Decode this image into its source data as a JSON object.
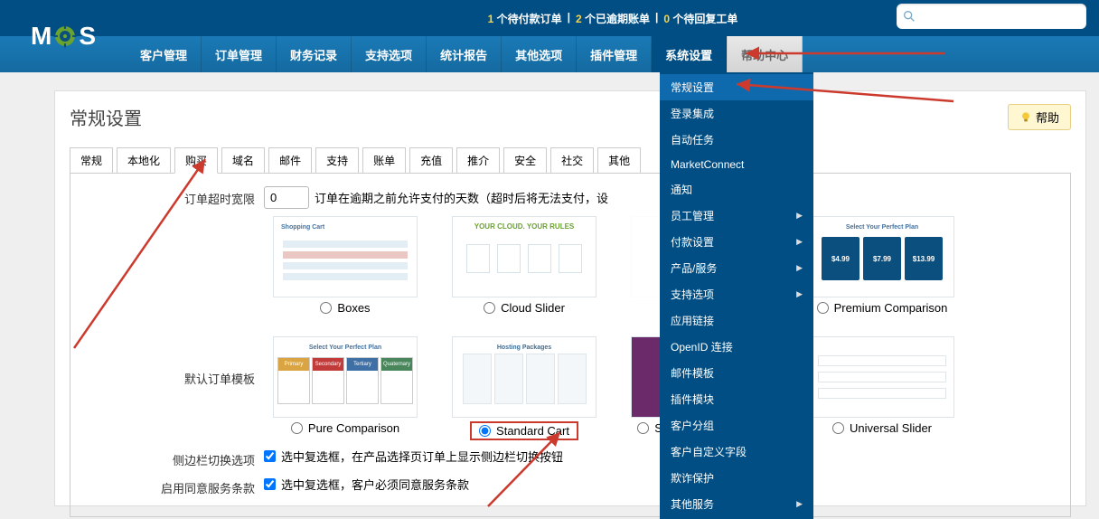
{
  "alerts": {
    "pending_payment_count": "1",
    "pending_payment_label": "个待付款订单",
    "overdue_count": "2",
    "overdue_label": "个已逾期账单",
    "pending_ticket_count": "0",
    "pending_ticket_label": "个待回复工单",
    "sep": "|"
  },
  "search": {
    "placeholder": ""
  },
  "nav": {
    "items": [
      "客户管理",
      "订单管理",
      "财务记录",
      "支持选项",
      "统计报告",
      "其他选项",
      "插件管理",
      "系统设置",
      "帮助中心"
    ],
    "active_index": 7
  },
  "dropdown": {
    "items": [
      {
        "label": "常规设置",
        "highlight": true,
        "sub": false
      },
      {
        "label": "登录集成",
        "sub": false
      },
      {
        "label": "自动任务",
        "sub": false
      },
      {
        "label": "MarketConnect",
        "sub": false
      },
      {
        "label": "通知",
        "sub": false
      },
      {
        "label": "员工管理",
        "sub": true
      },
      {
        "label": "付款设置",
        "sub": true
      },
      {
        "label": "产品/服务",
        "sub": true
      },
      {
        "label": "支持选项",
        "sub": true
      },
      {
        "label": "应用链接",
        "sub": false
      },
      {
        "label": "OpenID 连接",
        "sub": false
      },
      {
        "label": "邮件模板",
        "sub": false
      },
      {
        "label": "插件模块",
        "sub": false
      },
      {
        "label": "客户分组",
        "sub": false
      },
      {
        "label": "客户自定义字段",
        "sub": false
      },
      {
        "label": "欺诈保护",
        "sub": false
      },
      {
        "label": "其他服务",
        "sub": true
      }
    ]
  },
  "page": {
    "title": "常规设置",
    "help": "帮助"
  },
  "tabs": {
    "items": [
      "常规",
      "本地化",
      "购买",
      "域名",
      "邮件",
      "支持",
      "账单",
      "充值",
      "推介",
      "安全",
      "社交",
      "其他"
    ],
    "active_index": 2
  },
  "form": {
    "order_grace_label": "订单超时宽限",
    "order_grace_value": "0",
    "order_grace_desc": "订单在逾期之前允许支付的天数（超时后将无法支付，设",
    "default_template_label": "默认订单模板",
    "sidebar_toggle_label": "侧边栏切换选项",
    "sidebar_toggle_desc": "选中复选框，在产品选择页订单上显示侧边栏切换按钮",
    "tos_label": "启用同意服务条款",
    "tos_desc": "选中复选框，客户必须同意服务条款"
  },
  "templates": {
    "row1": [
      {
        "id": "boxes",
        "name": "Boxes",
        "selected": false
      },
      {
        "id": "cloud",
        "name": "Cloud Slider",
        "selected": false
      },
      {
        "id": "modern",
        "name": "",
        "selected": false
      },
      {
        "id": "premium",
        "name": "Premium Comparison",
        "selected": false
      }
    ],
    "row2": [
      {
        "id": "pure",
        "name": "Pure Comparison",
        "selected": false
      },
      {
        "id": "standard",
        "name": "Standard Cart",
        "selected": true,
        "highlight": true
      },
      {
        "id": "supreme",
        "name": "Supreme Comparison",
        "selected": false
      },
      {
        "id": "universal",
        "name": "Universal Slider",
        "selected": false
      }
    ],
    "thumb": {
      "select_plan": "Select Your Perfect Plan",
      "cloud_header": "YOUR CLOUD. YOUR RULES",
      "hosting": "Hosting Packages",
      "p1": "$4.99",
      "p2": "$7.99",
      "p3": "$13.99"
    }
  },
  "accent": "#cc3a2e"
}
